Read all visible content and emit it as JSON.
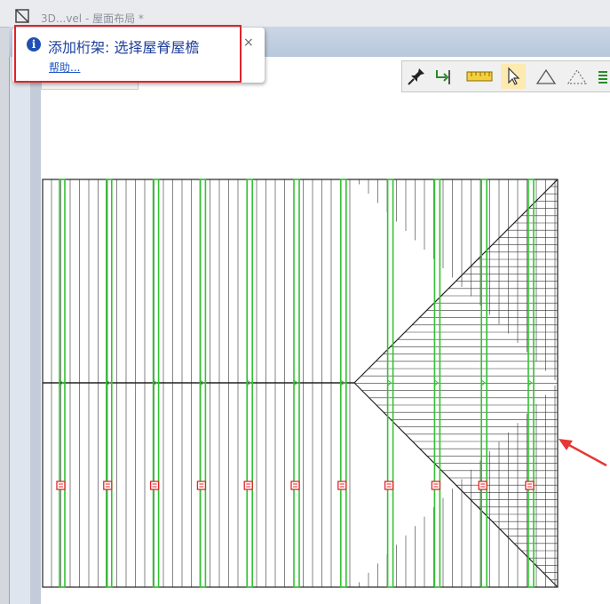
{
  "window": {
    "title": "3D...vel - 屋面布局 *"
  },
  "tooltip": {
    "title": "添加桁架: 选择屋脊屋檐",
    "help_link": "帮助...",
    "close_symbol": "×",
    "info_symbol": "i"
  },
  "toolbar": {
    "tools": [
      {
        "name": "pin-icon"
      },
      {
        "name": "trim-icon"
      },
      {
        "name": "ruler-icon"
      },
      {
        "name": "select-pointer-icon",
        "active": true
      },
      {
        "name": "triangle-icon"
      },
      {
        "name": "dashed-triangle-icon"
      },
      {
        "name": "layers-icon"
      }
    ]
  },
  "colors": {
    "truss_green": "#33c233",
    "marker_red": "#e0242b",
    "line_black": "#222222",
    "arrow_red": "#e53935"
  },
  "plan": {
    "truss_count": 11,
    "label_markers_count": 11
  }
}
